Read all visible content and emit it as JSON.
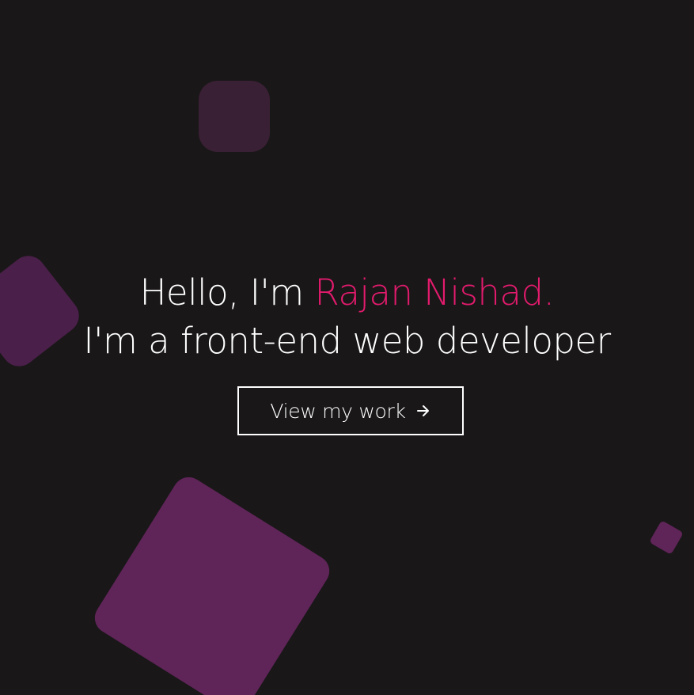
{
  "hero": {
    "greeting": "Hello, I'm ",
    "name": "Rajan Nishad.",
    "tagline": "I'm a front-end web developer",
    "cta_label": "View my work",
    "cta_icon": "arrow-right-icon"
  },
  "colors": {
    "background": "#191718",
    "text": "#ffffff",
    "accent": "#e31b6d",
    "shape_dark": "#3a2034",
    "shape_mid": "#4a1f49",
    "shape_bright": "#5f2458"
  }
}
